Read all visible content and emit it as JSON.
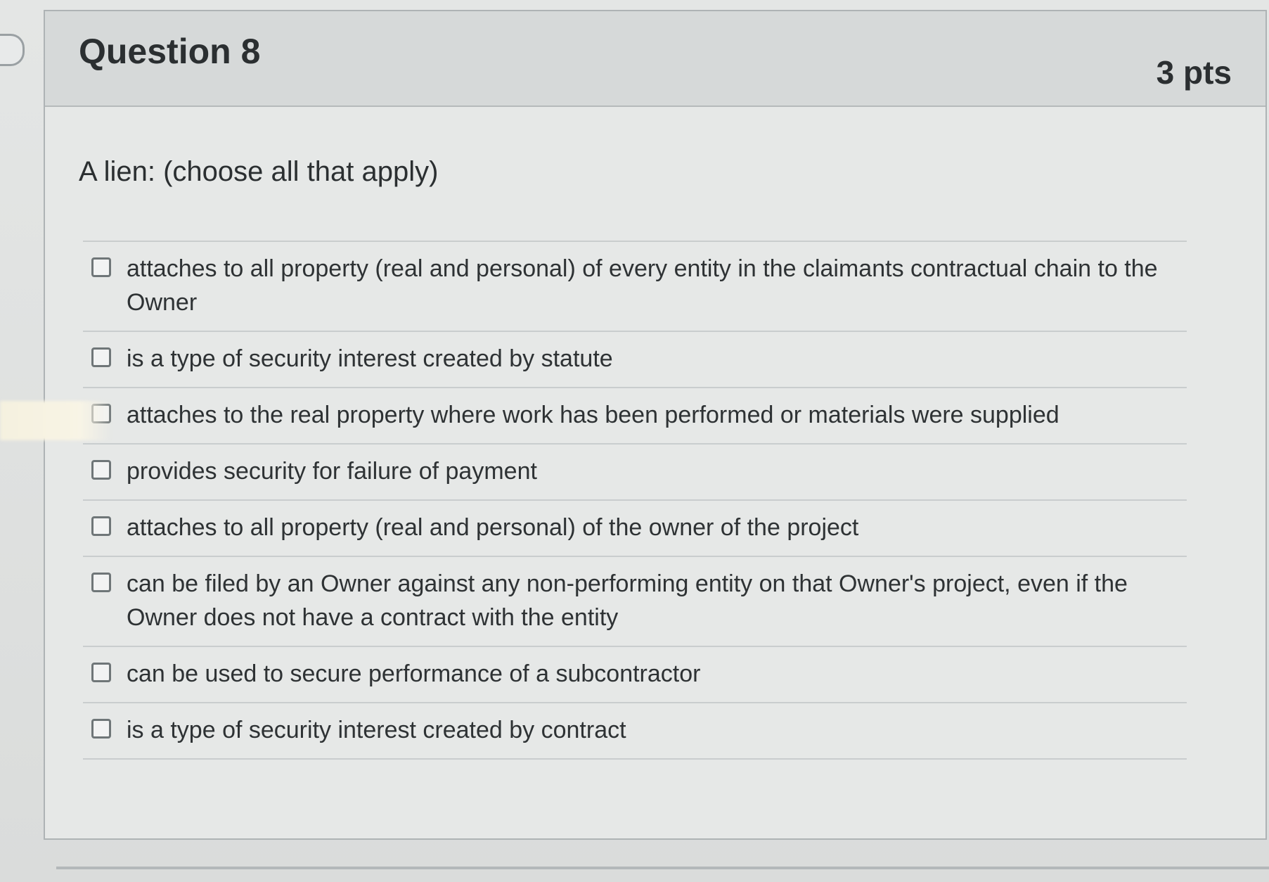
{
  "question": {
    "title": "Question 8",
    "points": "3 pts",
    "prompt": "A lien: (choose all that apply)"
  },
  "answers": [
    {
      "label": "attaches to all property (real and personal) of every entity in the claimants contractual chain to the Owner",
      "checked": false
    },
    {
      "label": "is a type of security interest created by statute",
      "checked": false
    },
    {
      "label": "attaches to the real property where work has been performed or materials were supplied",
      "checked": false
    },
    {
      "label": "provides security for failure of payment",
      "checked": false
    },
    {
      "label": "attaches to all property (real and personal) of the owner of the project",
      "checked": false
    },
    {
      "label": "can be filed by an Owner against any non-performing entity on that Owner's project, even if the Owner does not have a contract with the entity",
      "checked": false
    },
    {
      "label": "can be used to secure performance of a subcontractor",
      "checked": false
    },
    {
      "label": "is a type of security interest created by contract",
      "checked": false
    }
  ]
}
